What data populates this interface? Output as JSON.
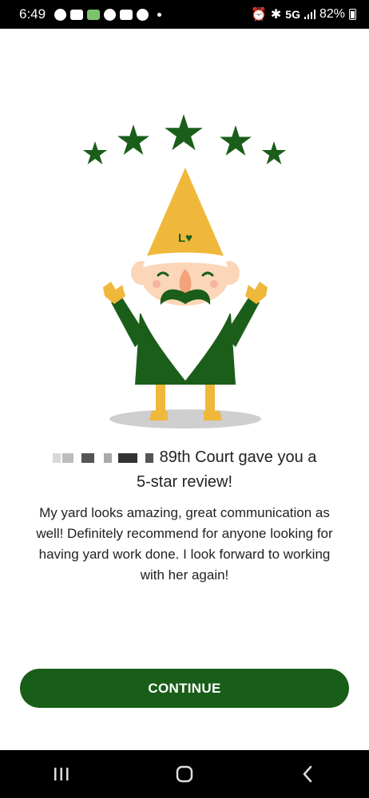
{
  "status_bar": {
    "time": "6:49",
    "network": "5G",
    "battery": "82%"
  },
  "illustration": {
    "stars": 5,
    "hat_logo": "L♥",
    "colors": {
      "green": "#1a5e1a",
      "yellow": "#f0b83a",
      "skin": "#fbd6b8",
      "nose": "#f3a27a",
      "beard": "#ffffff",
      "shadow": "#cfcfcf"
    }
  },
  "review": {
    "title_line1": "89th Court gave you a",
    "title_line2": "5-star review!",
    "body": "My yard looks amazing, great communication as well! Definitely recommend for anyone looking for having yard work done. I look forward to working with her again!"
  },
  "actions": {
    "continue_label": "CONTINUE"
  },
  "navigation": {
    "recents_icon": "recents-icon",
    "home_icon": "home-icon",
    "back_icon": "back-icon"
  }
}
